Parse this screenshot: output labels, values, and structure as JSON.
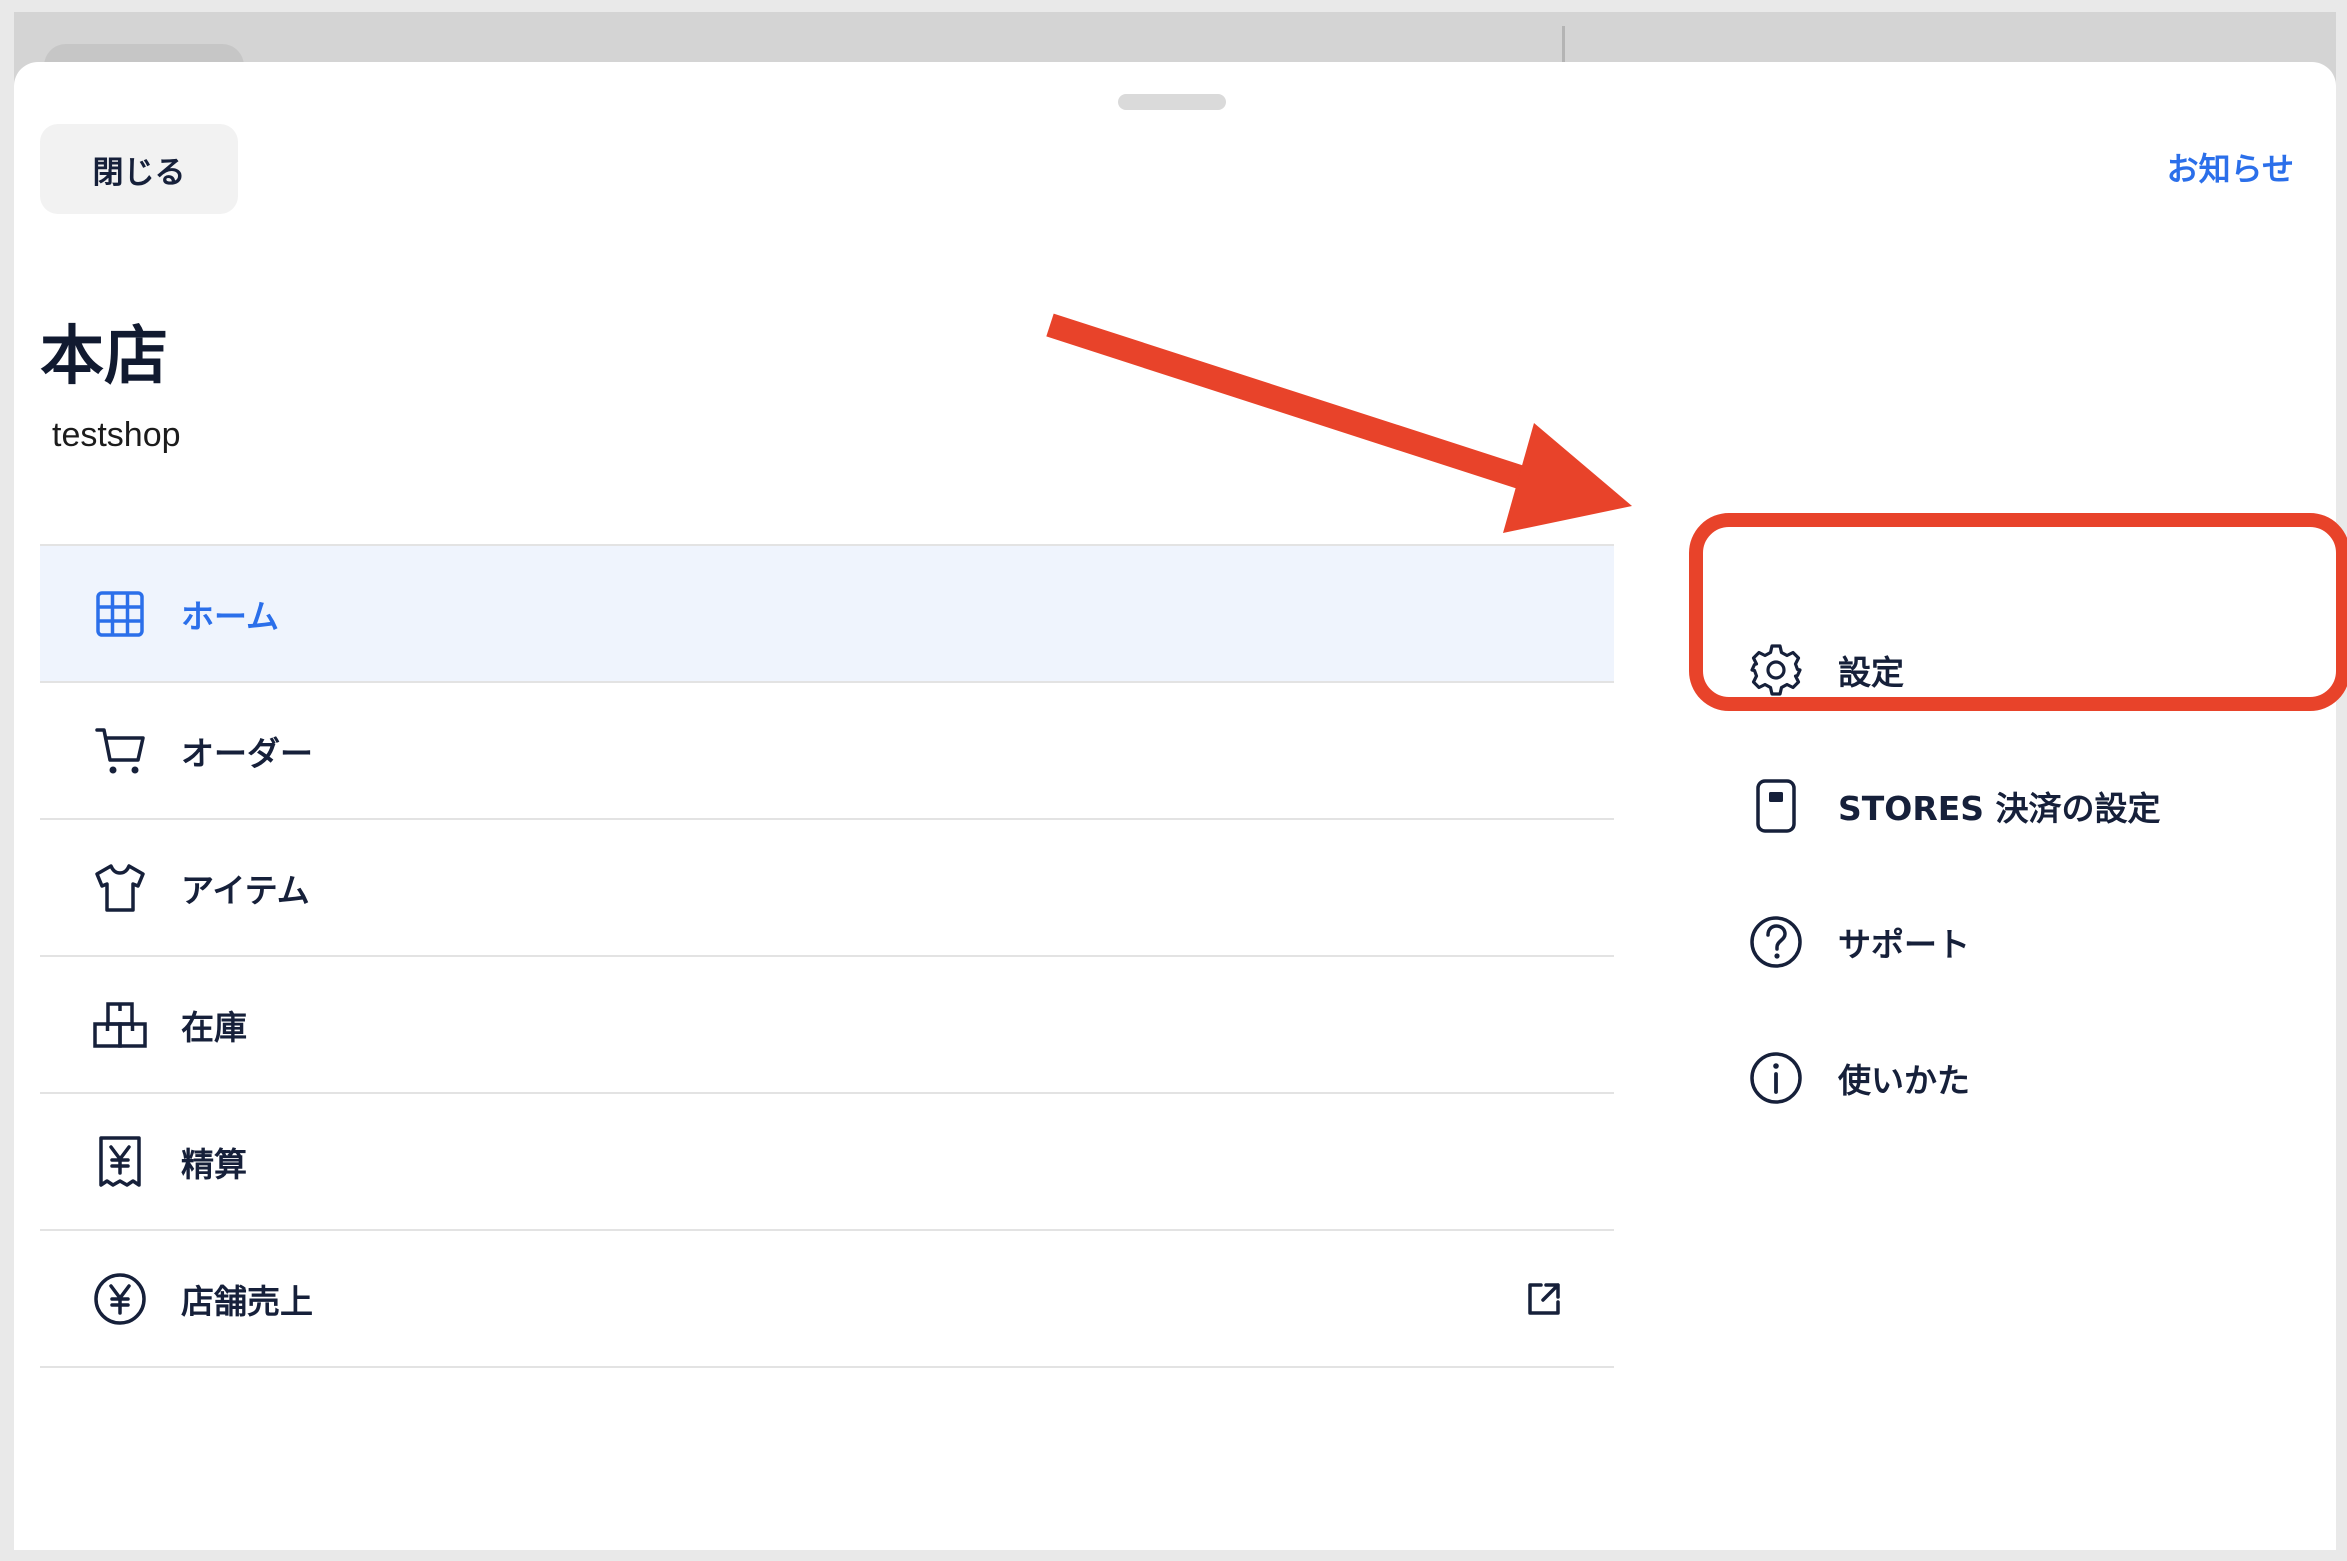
{
  "header": {
    "close_label": "閉じる",
    "news_label": "お知らせ"
  },
  "store": {
    "name": "本店",
    "shop_id": "testshop"
  },
  "main_nav": {
    "items": [
      {
        "label": "ホーム",
        "icon": "grid-icon",
        "active": true
      },
      {
        "label": "オーダー",
        "icon": "cart-icon"
      },
      {
        "label": "アイテム",
        "icon": "tshirt-icon"
      },
      {
        "label": "在庫",
        "icon": "boxes-icon"
      },
      {
        "label": "精算",
        "icon": "yen-receipt-icon"
      },
      {
        "label": "店舗売上",
        "icon": "yen-circle-icon",
        "trailing_icon": "external-link-icon"
      }
    ]
  },
  "side_menu": {
    "items": [
      {
        "label": "設定",
        "icon": "gear-icon",
        "highlighted": true
      },
      {
        "label": "STORES 決済の設定",
        "icon": "card-reader-icon"
      },
      {
        "label": "サポート",
        "icon": "question-circle-icon"
      },
      {
        "label": "使いかた",
        "icon": "info-circle-icon"
      }
    ]
  },
  "colors": {
    "accent": "#2b6fea",
    "text": "#16203a",
    "active_row_bg": "#eff4fd",
    "divider": "#e3e3e3",
    "annotation": "#e8432a"
  }
}
